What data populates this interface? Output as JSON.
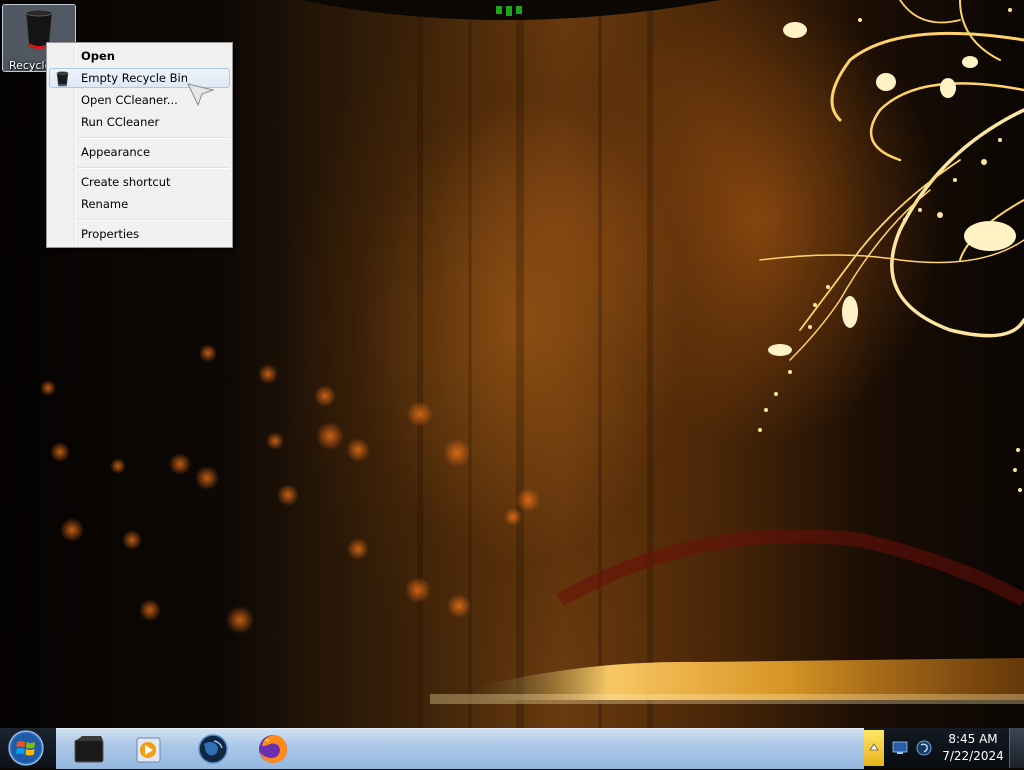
{
  "desktop": {
    "recycle_bin_label": "Recycle Bin"
  },
  "context_menu": {
    "items": [
      {
        "label": "Open"
      },
      {
        "label": "Empty Recycle Bin"
      },
      {
        "label": "Open CCleaner..."
      },
      {
        "label": "Run CCleaner"
      },
      {
        "label": "Appearance"
      },
      {
        "label": "Create shortcut"
      },
      {
        "label": "Rename"
      },
      {
        "label": "Properties"
      }
    ]
  },
  "taskbar": {
    "pinned": [
      {
        "icon": "file-manager-icon"
      },
      {
        "icon": "media-player-icon"
      },
      {
        "icon": "browser-globe-icon"
      },
      {
        "icon": "firefox-icon"
      }
    ],
    "clock": {
      "time": "8:45 AM",
      "date": "7/22/2024"
    }
  },
  "colors": {
    "taskbar_band": "#a9c6e6",
    "menu_highlight": "#dfe9f6",
    "wallpaper_glow": "#f5b93a"
  }
}
